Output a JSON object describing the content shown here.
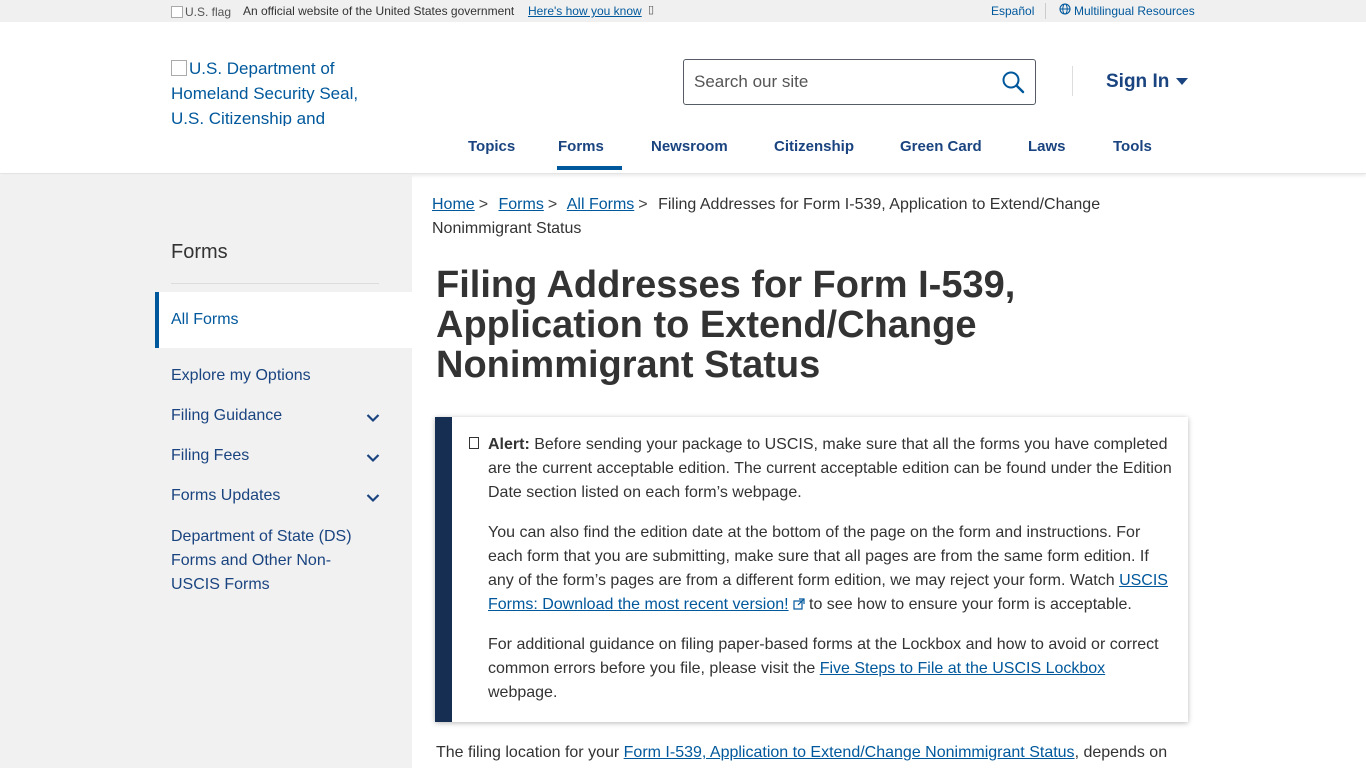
{
  "gov_banner": {
    "flag_alt": "U.S. flag",
    "official_text": "An official website of the United States government",
    "how_know_link": "Here's how you know",
    "espanol": "Español",
    "multilingual": "Multilingual Resources"
  },
  "header": {
    "logo_alt": "U.S. Department of Homeland Security Seal, U.S. Citizenship and",
    "search_placeholder": "Search our site",
    "signin_label": "Sign In"
  },
  "nav": {
    "items": [
      "Topics",
      "Forms",
      "Newsroom",
      "Citizenship",
      "Green Card",
      "Laws",
      "Tools"
    ],
    "active": "Forms"
  },
  "sidebar": {
    "title": "Forms",
    "active_item": "All Forms",
    "items": [
      "Explore my Options",
      "Filing Guidance",
      "Filing Fees",
      "Forms Updates"
    ],
    "ds_item": "Department of State (DS) Forms and Other Non-USCIS Forms"
  },
  "breadcrumb": {
    "home": "Home",
    "forms": "Forms",
    "all_forms": "All Forms",
    "current": "Filing Addresses for Form I-539, Application to Extend/Change Nonimmigrant Status",
    "separator": ">"
  },
  "page_title": "Filing Addresses for Form I-539, Application to Extend/Change Nonimmigrant Status",
  "alert": {
    "label": "Alert:",
    "p1": "Before sending your package to USCIS, make sure that all the forms you have completed are the current acceptable edition. The current acceptable edition can be found under the Edition Date section listed on each form’s webpage.",
    "p2_start": "You can also find the edition date at the bottom of the page on the form and instructions. For each form that you are submitting, make sure that all pages are from the same form edition. If any of the form’s pages are from a different form edition, we may reject your form. Watch ",
    "p2_link": "USCIS Forms: Download the most recent version!",
    "p2_end": " to see how to ensure your form is acceptable.",
    "p3_start": "For additional guidance on filing paper-based forms at the Lockbox and how to avoid or correct common errors before you file, please visit the ",
    "p3_link": "Five Steps to File at the USCIS Lockbox",
    "p3_end": " webpage."
  },
  "body": {
    "intro_start": "The filing location for your ",
    "intro_link": "Form I-539, Application to Extend/Change Nonimmigrant Status",
    "intro_end": ", depends on"
  },
  "colors": {
    "link": "#00589c",
    "nav_text": "#1a4480",
    "alert_border": "#162e51",
    "sidebar_bg": "#f1f1f1",
    "banner_bg": "#f0f0f0"
  }
}
